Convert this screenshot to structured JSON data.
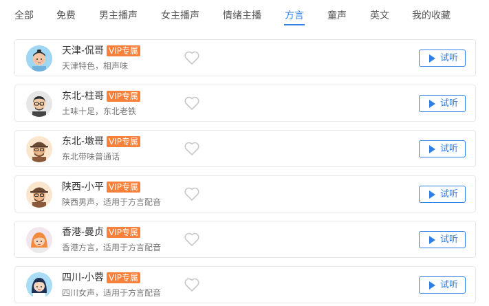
{
  "tabs": [
    {
      "label": "全部",
      "active": false
    },
    {
      "label": "免费",
      "active": false
    },
    {
      "label": "男主播声",
      "active": false
    },
    {
      "label": "女主播声",
      "active": false
    },
    {
      "label": "情绪主播",
      "active": false
    },
    {
      "label": "方言",
      "active": true
    },
    {
      "label": "童声",
      "active": false
    },
    {
      "label": "英文",
      "active": false
    },
    {
      "label": "我的收藏",
      "active": false
    }
  ],
  "accent_color": "#2f7fe6",
  "vip_color": "#f7803a",
  "voices": [
    {
      "name": "天津-侃哥",
      "badge": "VIP专属",
      "desc": "天津特色，相声味",
      "avatar": "tianjin-kange-avatar",
      "favorited": false,
      "button": "试听"
    },
    {
      "name": "东北-柱哥",
      "badge": "VIP专属",
      "desc": "土味十足，东北老铁",
      "avatar": "dongbei-zhuge-avatar",
      "favorited": false,
      "button": "试听"
    },
    {
      "name": "东北-墩哥",
      "badge": "VIP专属",
      "desc": "东北带味普通话",
      "avatar": "dongbei-dunge-avatar",
      "favorited": false,
      "button": "试听"
    },
    {
      "name": "陕西-小平",
      "badge": "VIP专属",
      "desc": "陕西男声，适用于方言配音",
      "avatar": "shaanxi-xiaoping-avatar",
      "favorited": false,
      "button": "试听"
    },
    {
      "name": "香港-曼贞",
      "badge": "VIP专属",
      "desc": "香港方言，适用于方言配音",
      "avatar": "hongkong-manzhen-avatar",
      "favorited": false,
      "button": "试听"
    },
    {
      "name": "四川-小蓉",
      "badge": "VIP专属",
      "desc": "四川女声，适用于方言配音",
      "avatar": "sichuan-xiaorong-avatar",
      "favorited": false,
      "button": "试听"
    }
  ]
}
